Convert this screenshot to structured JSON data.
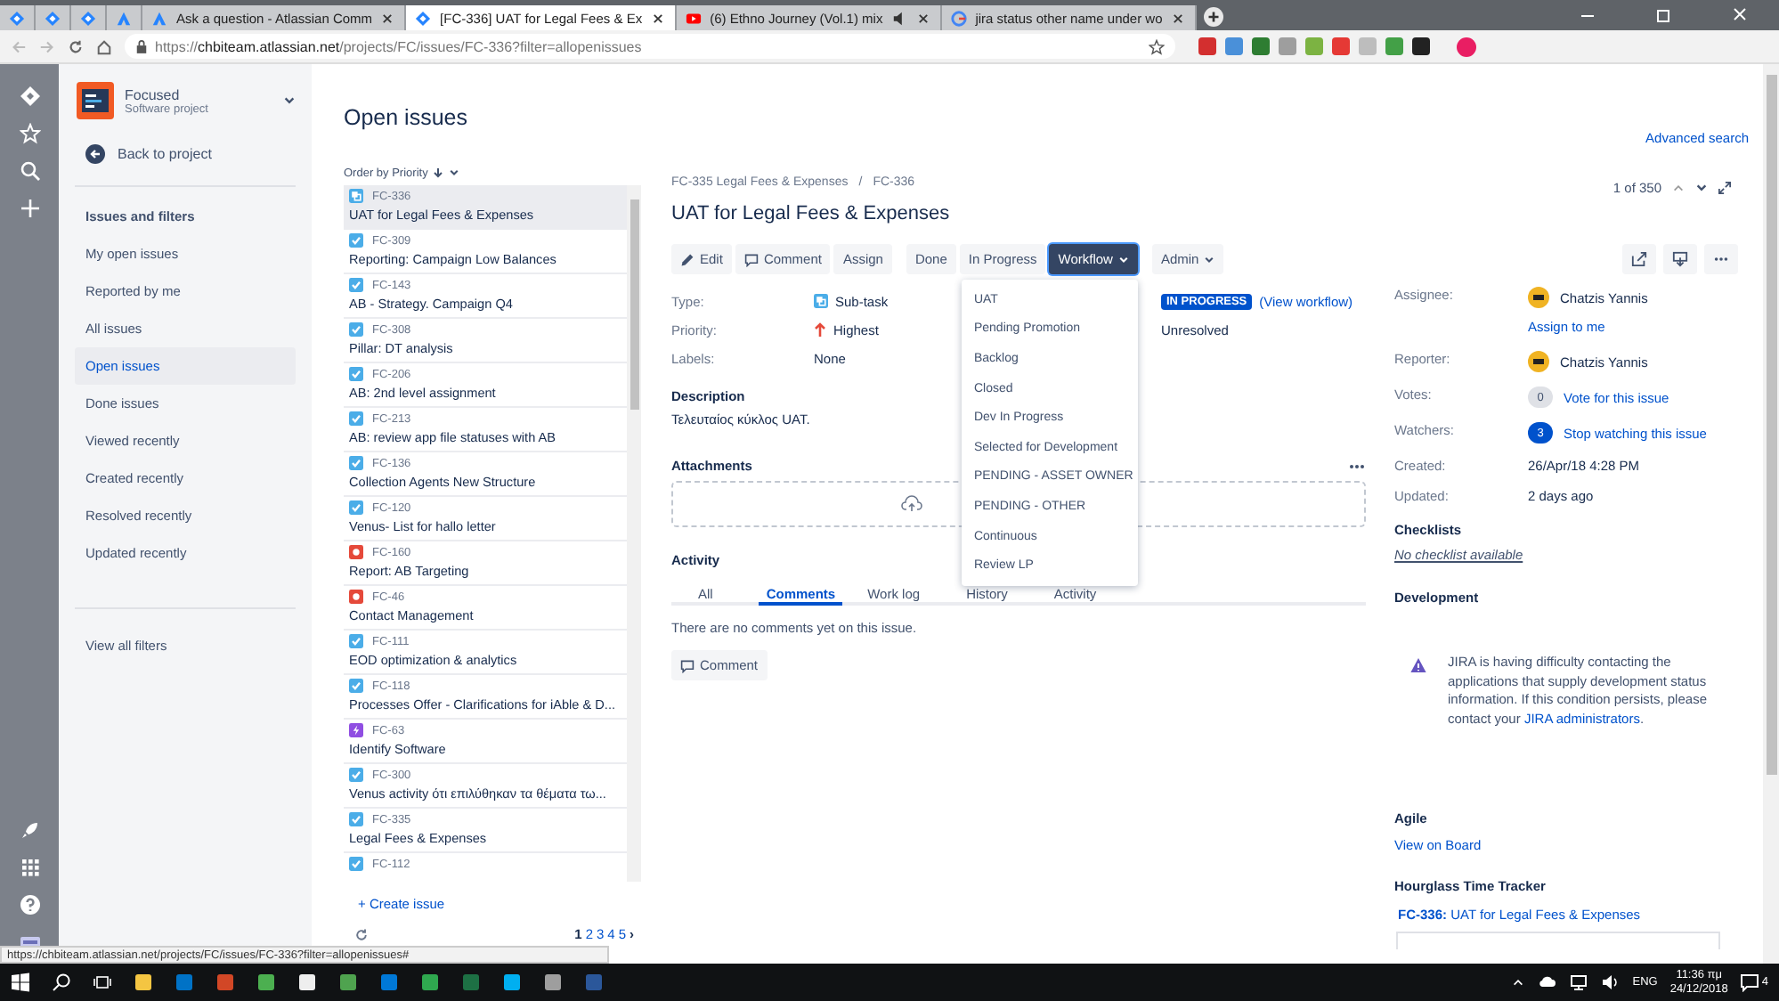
{
  "browser": {
    "tabs": [
      {
        "kind": "jira",
        "selected": false
      },
      {
        "kind": "jira",
        "selected": false
      },
      {
        "kind": "jira",
        "selected": false
      },
      {
        "kind": "atlassian",
        "selected": false
      },
      {
        "kind": "atlassian",
        "title": "Ask a question - Atlassian Comm",
        "selected": false
      },
      {
        "kind": "jira",
        "title": "[FC-336] UAT for Legal Fees & Ex",
        "selected": true
      },
      {
        "kind": "youtube",
        "title": "(6) Ethno Journey (Vol.1) mix",
        "audio": true,
        "selected": false
      },
      {
        "kind": "google",
        "title": "jira status other name under wo",
        "selected": false
      }
    ],
    "address": {
      "scheme": "https://",
      "host": "chbiteam.atlassian.net",
      "path": "/projects/FC/issues/FC-336?filter=allopenissues"
    }
  },
  "sidebar": {
    "project": {
      "name": "Focused",
      "type": "Software project"
    },
    "back": "Back to project",
    "section_title": "Issues and filters",
    "items": [
      {
        "label": "My open issues",
        "selected": false
      },
      {
        "label": "Reported by me",
        "selected": false
      },
      {
        "label": "All issues",
        "selected": false
      },
      {
        "label": "Open issues",
        "selected": true
      },
      {
        "label": "Done issues",
        "selected": false
      },
      {
        "label": "Viewed recently",
        "selected": false
      },
      {
        "label": "Created recently",
        "selected": false
      },
      {
        "label": "Resolved recently",
        "selected": false
      },
      {
        "label": "Updated recently",
        "selected": false
      }
    ],
    "view_all": "View all filters"
  },
  "issue_list": {
    "title": "Open issues",
    "order": "Order by Priority",
    "issues": [
      {
        "key": "FC-336",
        "summary": "UAT for Legal Fees & Expenses",
        "kind": "subtask",
        "selected": true
      },
      {
        "key": "FC-309",
        "summary": "Reporting: Campaign Low Balances",
        "kind": "task",
        "selected": false
      },
      {
        "key": "FC-143",
        "summary": "AB - Strategy. Campaign Q4",
        "kind": "task",
        "selected": false
      },
      {
        "key": "FC-308",
        "summary": "Pillar: DT analysis",
        "kind": "task",
        "selected": false
      },
      {
        "key": "FC-206",
        "summary": "AB: 2nd level assignment",
        "kind": "task",
        "selected": false
      },
      {
        "key": "FC-213",
        "summary": "AB: review app file statuses with AB",
        "kind": "task",
        "selected": false
      },
      {
        "key": "FC-136",
        "summary": "Collection Agents New Structure",
        "kind": "task",
        "selected": false
      },
      {
        "key": "FC-120",
        "summary": "Venus- List for hallo letter",
        "kind": "task",
        "selected": false
      },
      {
        "key": "FC-160",
        "summary": "Report: AB Targeting",
        "kind": "bug",
        "selected": false
      },
      {
        "key": "FC-46",
        "summary": "Contact Management",
        "kind": "bug",
        "selected": false
      },
      {
        "key": "FC-111",
        "summary": "EOD optimization & analytics",
        "kind": "task",
        "selected": false
      },
      {
        "key": "FC-118",
        "summary": "Processes Offer - Clarifications for iAble & D...",
        "kind": "task",
        "selected": false
      },
      {
        "key": "FC-63",
        "summary": "Identify Software",
        "kind": "epic",
        "selected": false
      },
      {
        "key": "FC-300",
        "summary": "Venus activity ότι επιλύθηκαν τα θέματα τω...",
        "kind": "task",
        "selected": false
      },
      {
        "key": "FC-335",
        "summary": "Legal Fees & Expenses",
        "kind": "task",
        "selected": false
      },
      {
        "key": "FC-112",
        "kind": "task",
        "selected": false
      }
    ],
    "create": "+ Create issue",
    "pages": [
      {
        "label": "1",
        "selected": true
      },
      {
        "label": "2",
        "selected": false
      },
      {
        "label": "3",
        "selected": false
      },
      {
        "label": "4",
        "selected": false
      },
      {
        "label": "5",
        "selected": false
      }
    ],
    "next": "›"
  },
  "issue": {
    "advanced_search": "Advanced search",
    "breadcrumbs": [
      "FC-335 Legal Fees & Expenses",
      "FC-336"
    ],
    "breadcrumb_separator": "/",
    "title": "UAT for Legal Fees & Expenses",
    "pager": "1 of 350",
    "toolbar": [
      [
        {
          "label": "Edit",
          "kind": "edit"
        },
        {
          "label": "Comment",
          "kind": "comment"
        },
        {
          "label": "Assign",
          "kind": "plain"
        }
      ],
      [
        {
          "label": "Done",
          "kind": "plain"
        },
        {
          "label": "In Progress",
          "kind": "plain"
        },
        {
          "label": "Workflow",
          "kind": "menu",
          "open": true
        }
      ],
      [
        {
          "label": "Admin",
          "kind": "menu",
          "open": false
        }
      ]
    ],
    "workflow_menu": [
      "UAT",
      "Pending Promotion",
      "Backlog",
      "Closed",
      "Dev In Progress",
      "Selected for Development",
      "PENDING - ASSET OWNER",
      "PENDING - OTHER",
      "Continuous",
      "Review LP"
    ],
    "fields": [
      {
        "label": "Type:",
        "value": "Sub-task",
        "kind": "type"
      },
      {
        "label": "Priority:",
        "value": "Highest",
        "kind": "priority"
      },
      {
        "label": "Labels:",
        "value": "None",
        "kind": "text"
      }
    ],
    "status": "IN PROGRESS",
    "view_workflow": "(View workflow)",
    "resolution": "Unresolved",
    "description_title": "Description",
    "description": "Τελευταίος κύκλος UAT.",
    "attachments_title": "Attachments",
    "activity_title": "Activity",
    "activity_tabs": [
      {
        "label": "All",
        "selected": false
      },
      {
        "label": "Comments",
        "selected": true
      },
      {
        "label": "Work log",
        "selected": false
      },
      {
        "label": "History",
        "selected": false
      },
      {
        "label": "Activity",
        "selected": false
      }
    ],
    "no_comments": "There are no comments yet on this issue.",
    "comment_button": "Comment",
    "people": [
      {
        "label": "Assignee:",
        "value": "Chatzis Yannis",
        "kind": "user",
        "link": "Assign to me"
      },
      {
        "label": "Reporter:",
        "value": "Chatzis Yannis",
        "kind": "user"
      },
      {
        "label": "Votes:",
        "count": "0",
        "value": "Vote for this issue",
        "kind": "count",
        "on": false
      },
      {
        "label": "Watchers:",
        "count": "3",
        "value": "Stop watching this issue",
        "kind": "count",
        "on": true
      },
      {
        "label": "Created:",
        "value": "26/Apr/18 4:28 PM",
        "kind": "text"
      },
      {
        "label": "Updated:",
        "value": "2 days ago",
        "kind": "text"
      }
    ],
    "checklists_title": "Checklists",
    "no_checklist": "No checklist available",
    "development_title": "Development",
    "warning": "JIRA is having difficulty contacting the applications that supply development status information. If this condition persists, please contact your",
    "warning_link": "JIRA administrators",
    "warning_end": ".",
    "agile_title": "Agile",
    "view_on_board": "View on Board",
    "hourglass_title": "Hourglass Time Tracker",
    "hourglass_key": "FC-336:",
    "hourglass_summary": "UAT for Legal Fees & Expenses"
  },
  "status_url": "https://chbiteam.atlassian.net/projects/FC/issues/FC-336?filter=allopenissues#",
  "taskbar": {
    "language": "ENG",
    "time": "11:36 πμ",
    "date": "24/12/2018",
    "notifications": "4"
  }
}
